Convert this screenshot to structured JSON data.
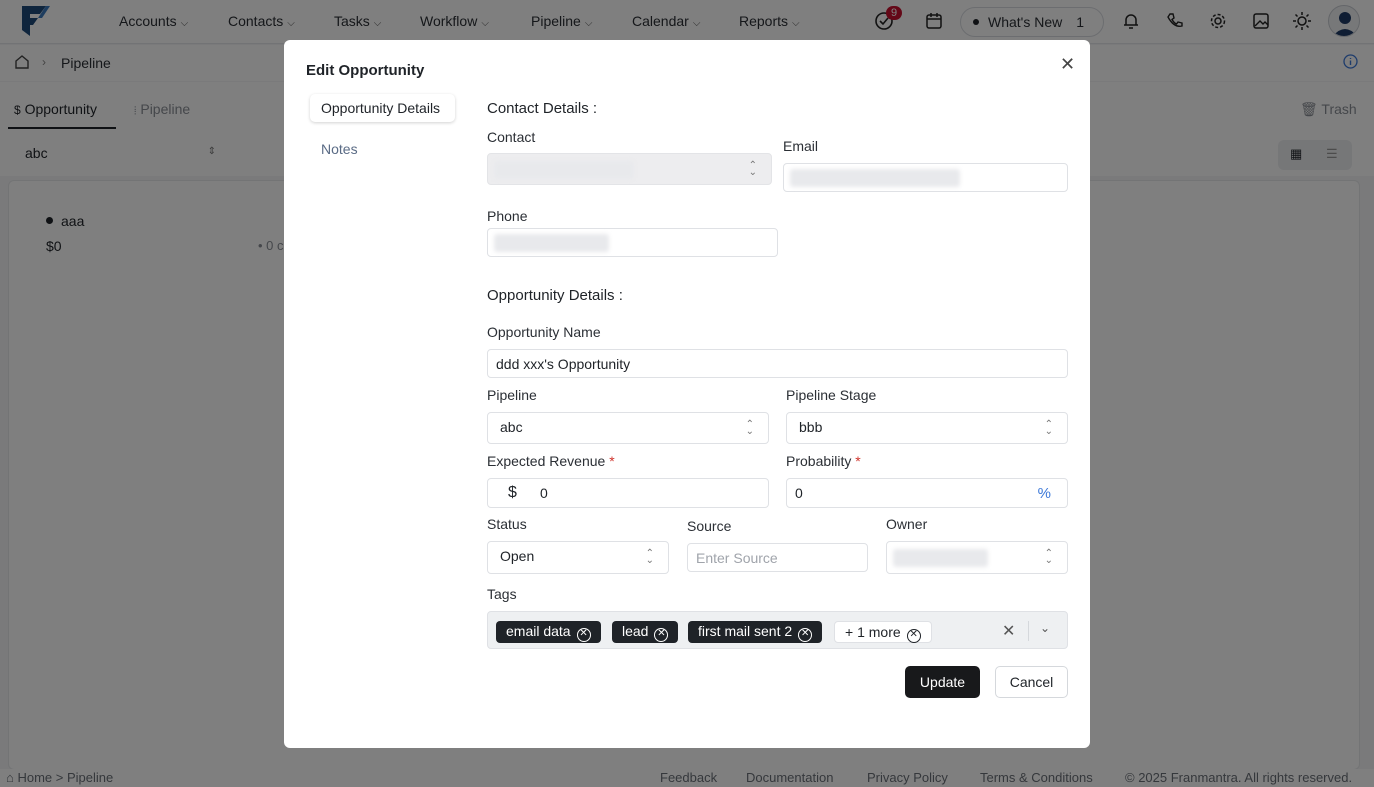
{
  "nav": {
    "items": [
      "Accounts",
      "Contacts",
      "Tasks",
      "Workflow",
      "Pipeline",
      "Calendar",
      "Reports"
    ],
    "tasks_badge": "9",
    "whats_new_label": "What's New",
    "whats_new_count": "1"
  },
  "breadcrumb": {
    "page": "Pipeline"
  },
  "tabs": {
    "opportunity": "Opportunity",
    "pipeline": "Pipeline",
    "trash": "Trash"
  },
  "filter": {
    "pipeline_value": "abc"
  },
  "board": {
    "column_name": "aaa",
    "column_amount": "$0",
    "column_count": "• 0 c"
  },
  "footer": {
    "breadcrumb": "⌂ Home > Pipeline",
    "links": [
      "Feedback",
      "Documentation",
      "Privacy Policy",
      "Terms & Conditions"
    ],
    "copyright": "© 2025 Franmantra. All rights reserved."
  },
  "modal": {
    "title": "Edit Opportunity",
    "side_tabs": [
      "Opportunity Details",
      "Notes"
    ],
    "contact_section_title": "Contact Details :",
    "contact_label": "Contact",
    "email_label": "Email",
    "phone_label": "Phone",
    "opportunity_section_title": "Opportunity Details :",
    "opportunity_name_label": "Opportunity Name",
    "opportunity_name_value": "ddd xxx's Opportunity",
    "pipeline_label": "Pipeline",
    "pipeline_value": "abc",
    "stage_label": "Pipeline Stage",
    "stage_value": "bbb",
    "revenue_label": "Expected Revenue",
    "revenue_currency": "$",
    "revenue_value": "0",
    "probability_label": "Probability",
    "probability_value": "0",
    "probability_unit": "%",
    "required_mark": "*",
    "status_label": "Status",
    "status_value": "Open",
    "source_label": "Source",
    "source_placeholder": "Enter Source",
    "owner_label": "Owner",
    "tags_label": "Tags",
    "tags": [
      "email data",
      "lead",
      "first mail sent 2"
    ],
    "tags_more": "+ 1 more",
    "update_label": "Update",
    "cancel_label": "Cancel"
  },
  "colors": {
    "primary": "#18191b",
    "required": "#d0342c",
    "percent": "#3c78d8",
    "badge": "#c8102e"
  }
}
